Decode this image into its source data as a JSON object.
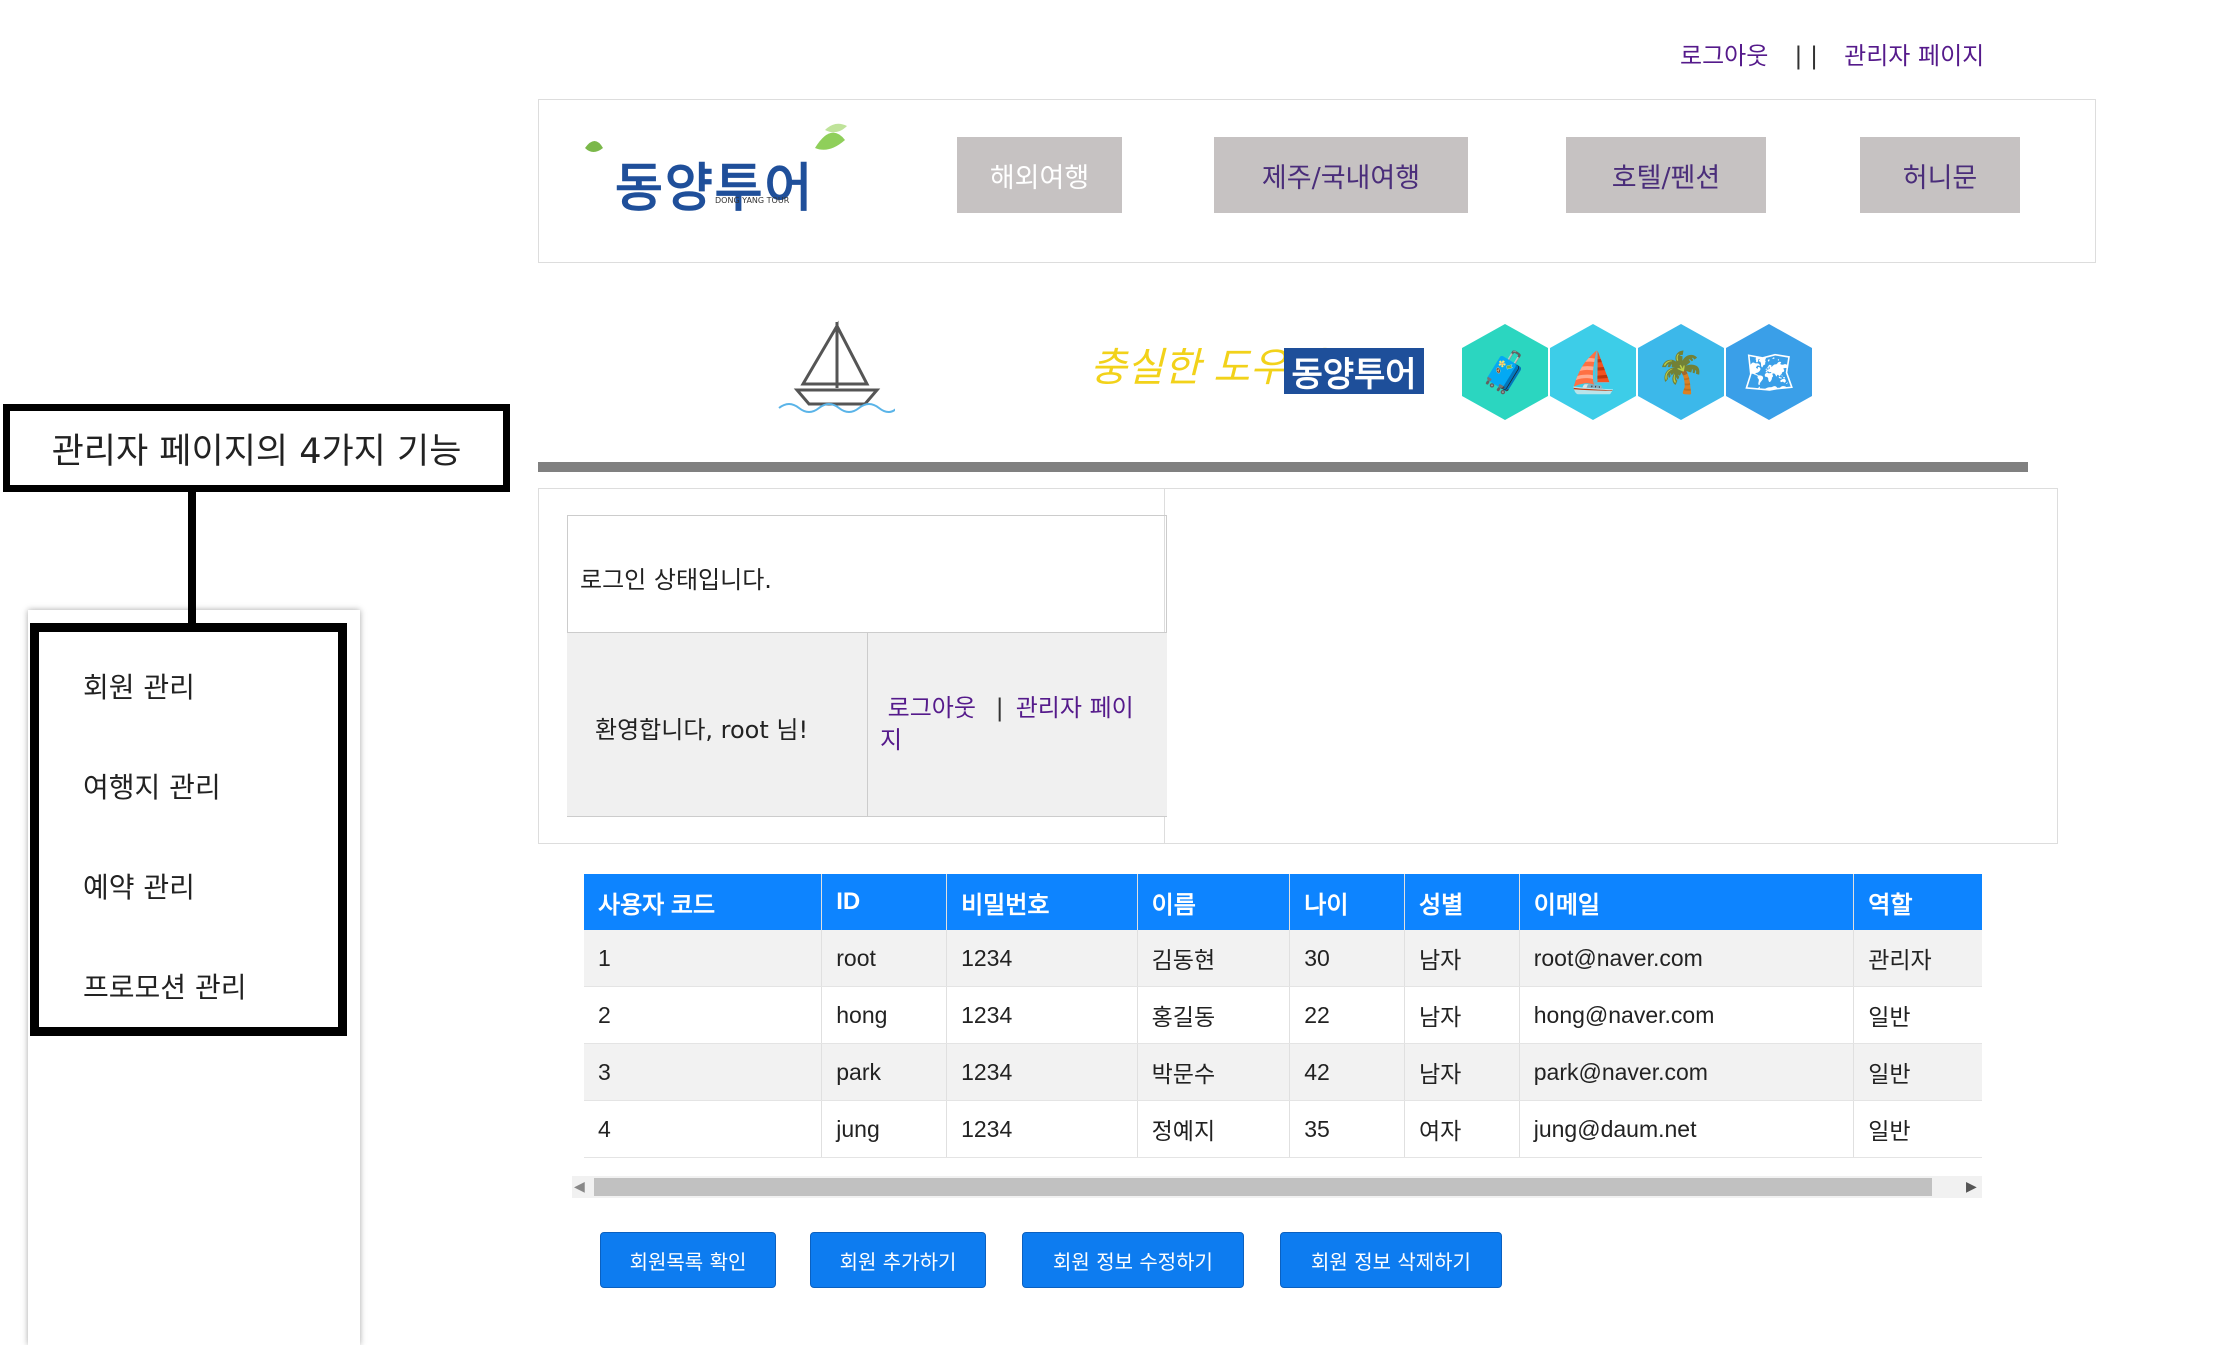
{
  "top_links": {
    "logout": "로그아웃",
    "separator": "| |",
    "admin": "관리자 페이지"
  },
  "header": {
    "logo_text": "동양투어",
    "logo_sub": "DONG YANG TOUR",
    "nav": [
      "해외여행",
      "제주/국내여행",
      "호텔/펜션",
      "허니문"
    ]
  },
  "banner": {
    "slogan": "충실한 도우미",
    "brand": "동양투어"
  },
  "login": {
    "status": "로그인 상태입니다.",
    "welcome": "환영합니다, root 님!",
    "logout": "로그아웃",
    "separator": "|",
    "admin": "관리자 페이지"
  },
  "table": {
    "headers": [
      "사용자 코드",
      "ID",
      "비밀번호",
      "이름",
      "나이",
      "성별",
      "이메일",
      "역할"
    ],
    "rows": [
      [
        "1",
        "root",
        "1234",
        "김동현",
        "30",
        "남자",
        "root@naver.com",
        "관리자"
      ],
      [
        "2",
        "hong",
        "1234",
        "홍길동",
        "22",
        "남자",
        "hong@naver.com",
        "일반"
      ],
      [
        "3",
        "park",
        "1234",
        "박문수",
        "42",
        "남자",
        "park@naver.com",
        "일반"
      ],
      [
        "4",
        "jung",
        "1234",
        "정예지",
        "35",
        "여자",
        "jung@daum.net",
        "일반"
      ]
    ]
  },
  "buttons": [
    "회원목록 확인",
    "회원 추가하기",
    "회원 정보 수정하기",
    "회원 정보 삭제하기"
  ],
  "annotation": {
    "title": "관리자 페이지의 4가지 기능"
  },
  "sidebar": {
    "items": [
      "회원 관리",
      "여행지 관리",
      "예약 관리",
      "프로모션 관리"
    ]
  },
  "colors": {
    "accent": "#0d84ff",
    "nav_bg": "#c6c2c2",
    "link": "#551a8b"
  }
}
